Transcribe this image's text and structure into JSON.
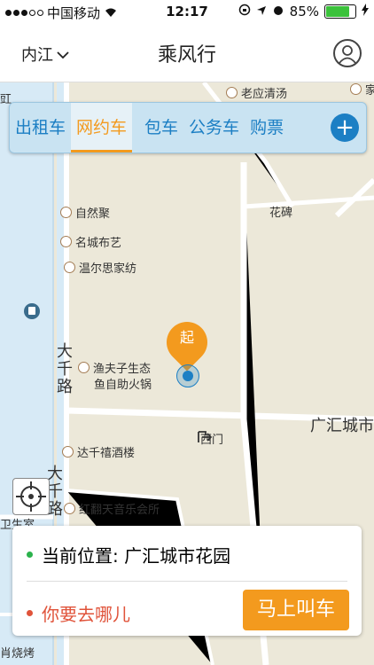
{
  "status_bar": {
    "carrier": "中国移动",
    "time": "12:17",
    "battery": "85%",
    "battery_level": 0.85
  },
  "nav": {
    "city": "内江",
    "title": "乘风行"
  },
  "tabs": [
    {
      "label": "出租车"
    },
    {
      "label": "网约车"
    },
    {
      "label": "包车"
    },
    {
      "label": "公务车"
    },
    {
      "label": "购票"
    }
  ],
  "add_label": "+",
  "map": {
    "pois": [
      "老应清汤",
      "自然聚",
      "名城布艺",
      "温尔思家纺",
      "渔夫子生态",
      "鱼自助火锅",
      "达千禧酒楼",
      "红翻天音乐会所",
      "西门",
      "花碑",
      "肖烧烤",
      "卫生室",
      "豇",
      "家"
    ],
    "road_labels": [
      "广汇城市",
      "大千路",
      "大千路"
    ],
    "pin_label": "起"
  },
  "card": {
    "current_prefix": "当前位置: ",
    "current_location": "广汇城市花园",
    "destination_placeholder": "你要去哪儿",
    "call_button": "马上叫车"
  },
  "colors": {
    "accent": "#f39a1e",
    "brand_blue": "#1c7fc4",
    "current_dot": "#2bb24c",
    "destination_dot": "#e0533a"
  }
}
